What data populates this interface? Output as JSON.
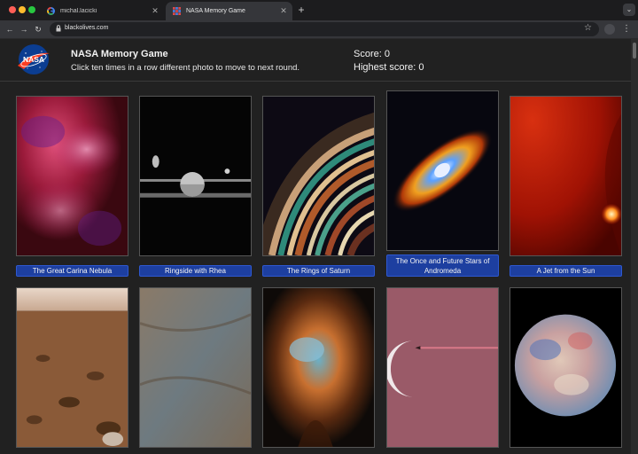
{
  "browser": {
    "tabs": [
      {
        "title": "michal.lacicki"
      },
      {
        "title": "NASA Memory Game"
      }
    ],
    "new_tab_label": "+",
    "url": "blackolives.com"
  },
  "header": {
    "logo_text": "NASA",
    "title": "NASA Memory Game",
    "subtitle": "Click ten times in a row different photo to move to next round.",
    "score_label": "Score: 0",
    "highest_score_label": "Highest score: 0"
  },
  "cards_row1": [
    {
      "caption": "The Great Carina Nebula"
    },
    {
      "caption": "Ringside with Rhea"
    },
    {
      "caption": "The Rings of Saturn"
    },
    {
      "caption": "The Once and Future Stars of Andromeda"
    },
    {
      "caption": "A Jet from the Sun"
    }
  ],
  "colors": {
    "page_bg": "#212121",
    "caption_bg": "#1d3fa0",
    "caption_border": "#2e58d0"
  }
}
